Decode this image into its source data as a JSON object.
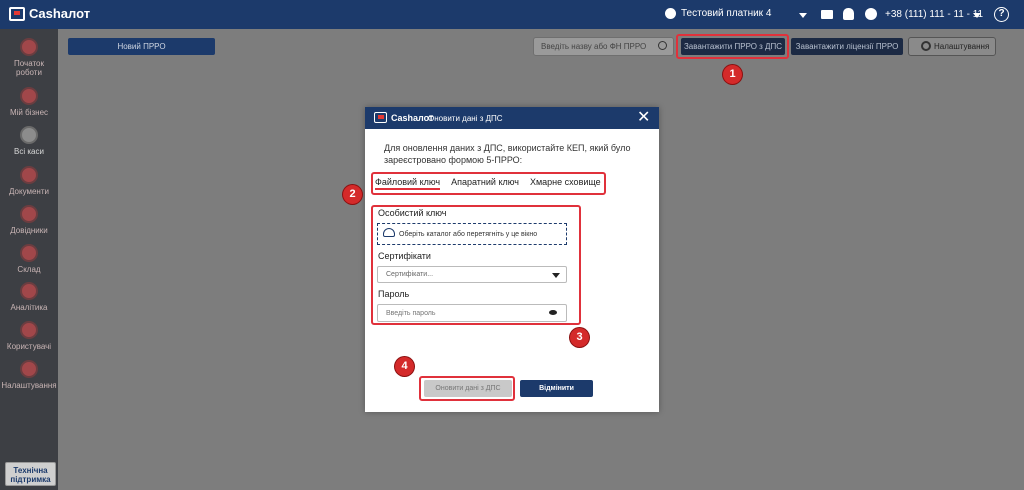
{
  "topbar": {
    "logo": "Cashалот",
    "payer": "Тестовий платник 4",
    "phone": "+38 (111) 111 - 11 - 11",
    "help": "?"
  },
  "sidebar": {
    "items": [
      {
        "label": "Початок роботи",
        "active": false
      },
      {
        "label": "Мій бізнес",
        "active": false
      },
      {
        "label": "Всі каси",
        "active": true
      },
      {
        "label": "Документи",
        "active": false
      },
      {
        "label": "Довідники",
        "active": false
      },
      {
        "label": "Склад",
        "active": false
      },
      {
        "label": "Аналітика",
        "active": false
      },
      {
        "label": "Користувачі",
        "active": false
      },
      {
        "label": "Налаштування",
        "active": false
      }
    ],
    "support": "Технічна підтримка"
  },
  "toolbar": {
    "new_prro": "Новий ПРРО",
    "search_placeholder": "Введіть назву або ФН ПРРО",
    "load_dps": "Завантажити ПРРО з ДПС",
    "load_license": "Завантажити ліцензії ПРРО",
    "settings": "Налаштування"
  },
  "modal": {
    "logo": "Cashалот",
    "title": "Оновити дані з ДПС",
    "info": "Для оновлення даних з ДПС, використайте КЕП, який було зареєстровано формою 5-ПРРО:",
    "tabs": [
      {
        "label": "Файловий ключ",
        "active": true
      },
      {
        "label": "Апаратний ключ",
        "active": false
      },
      {
        "label": "Хмарне сховище",
        "active": false
      }
    ],
    "private_key_label": "Особистий ключ",
    "dropzone_text": "Оберіть каталог або перетягніть у це вікно",
    "certificates_label": "Сертифікати",
    "certificates_placeholder": "Сертифікати...",
    "password_label": "Пароль",
    "password_placeholder": "Введіть пароль",
    "update_button": "Оновити дані з ДПС",
    "cancel_button": "Відмінити"
  },
  "annotations": [
    "1",
    "2",
    "3",
    "4"
  ],
  "colors": {
    "brand": "#1c3a6b",
    "annotation": "#e0313b",
    "sidebar": "#3d3f44"
  }
}
